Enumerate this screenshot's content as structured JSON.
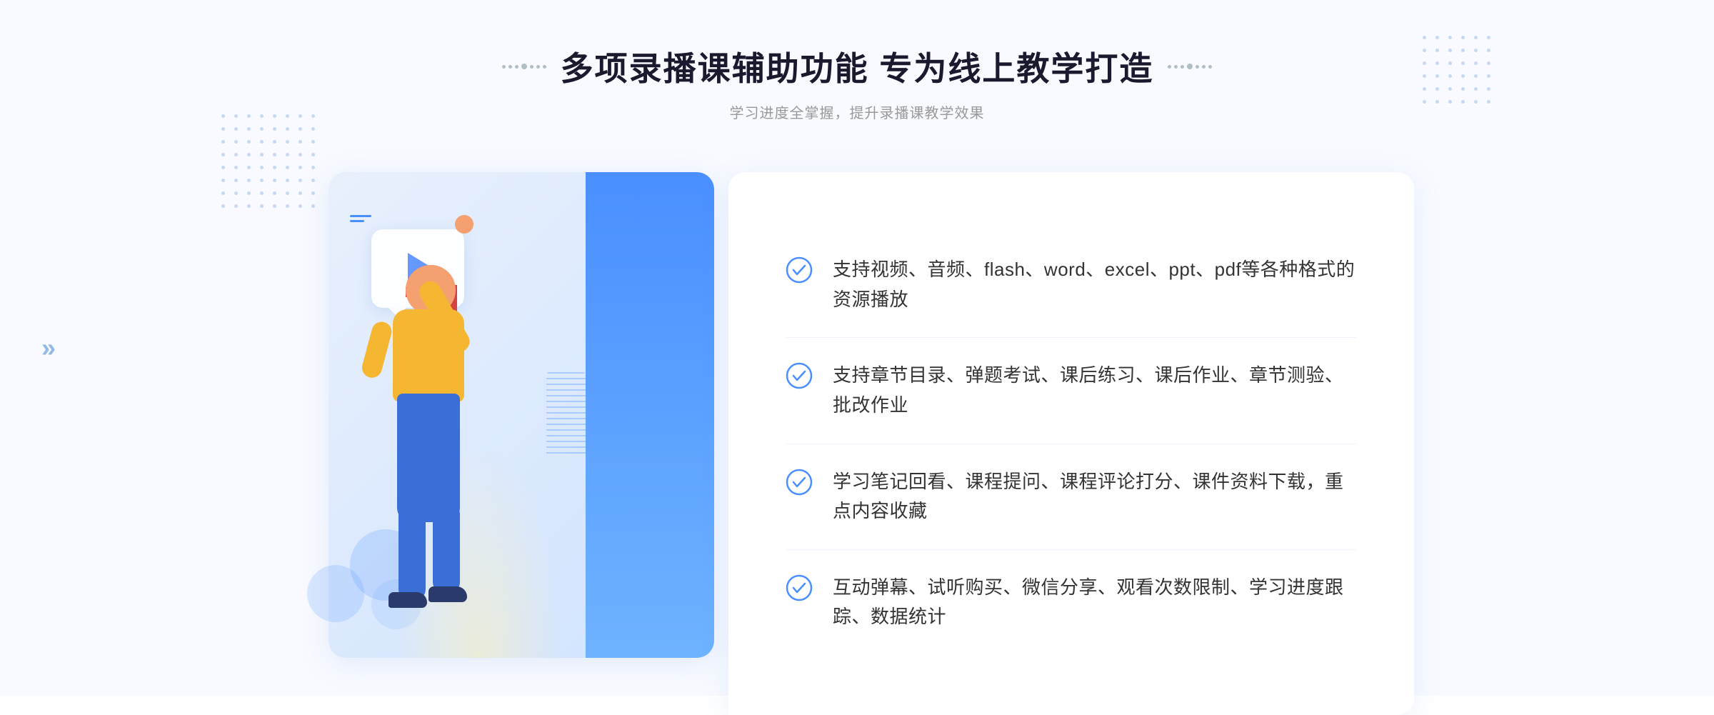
{
  "header": {
    "title": "多项录播课辅助功能 专为线上教学打造",
    "subtitle": "学习进度全掌握，提升录播课教学效果"
  },
  "features": [
    {
      "id": "feature-1",
      "text": "支持视频、音频、flash、word、excel、ppt、pdf等各种格式的资源播放"
    },
    {
      "id": "feature-2",
      "text": "支持章节目录、弹题考试、课后练习、课后作业、章节测验、批改作业"
    },
    {
      "id": "feature-3",
      "text": "学习笔记回看、课程提问、课程评论打分、课件资料下载，重点内容收藏"
    },
    {
      "id": "feature-4",
      "text": "互动弹幕、试听购买、微信分享、观看次数限制、学习进度跟踪、数据统计"
    }
  ],
  "icons": {
    "check": "check-circle-icon",
    "chevron": "chevron-double-icon"
  },
  "colors": {
    "primary": "#4a8fff",
    "secondary": "#6eb3ff",
    "text_dark": "#1a1a2e",
    "text_medium": "#333333",
    "text_light": "#999999",
    "accent_yellow": "#f5b731",
    "accent_red": "#d44444",
    "bg_light": "#f8faff"
  }
}
